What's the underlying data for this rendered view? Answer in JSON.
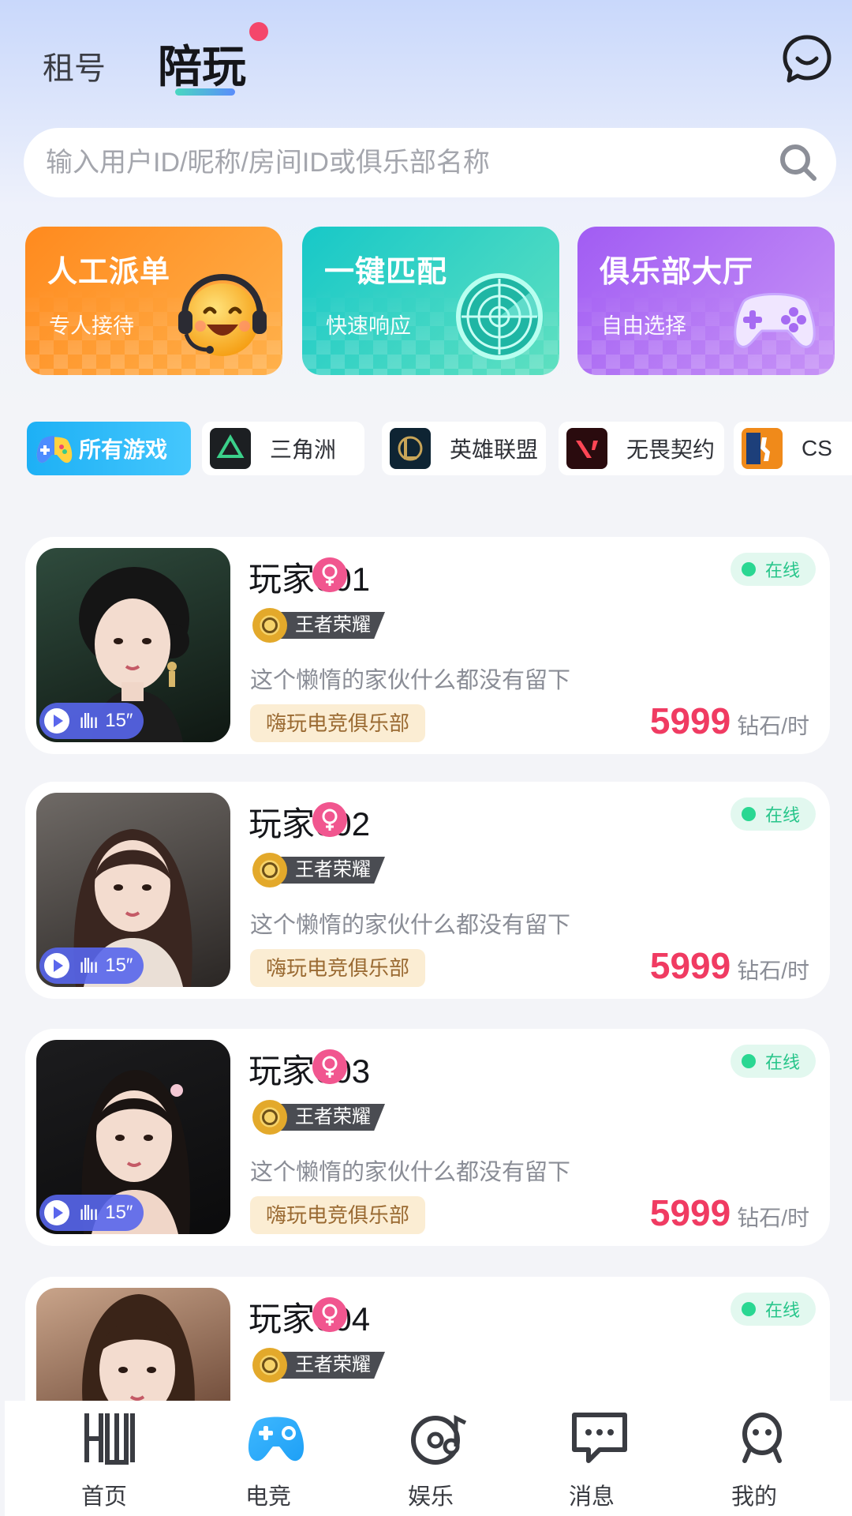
{
  "header": {
    "tab_rent": "租号",
    "tab_play": "陪玩"
  },
  "search": {
    "placeholder": "输入用户ID/昵称/房间ID或俱乐部名称"
  },
  "features": [
    {
      "title": "人工派单",
      "subtitle": "专人接待"
    },
    {
      "title": "一键匹配",
      "subtitle": "快速响应"
    },
    {
      "title": "俱乐部大厅",
      "subtitle": "自由选择"
    }
  ],
  "game_tabs": [
    {
      "label": "所有游戏",
      "active": true
    },
    {
      "label": "三角洲",
      "logo_text": "三角洲行动"
    },
    {
      "label": "英雄联盟"
    },
    {
      "label": "无畏契约",
      "logo_text": "无畏契约"
    },
    {
      "label": "CS"
    }
  ],
  "players": [
    {
      "name": "玩家001",
      "rank": "王者荣耀",
      "desc": "这个懒惰的家伙什么都没有留下",
      "club": "嗨玩电竞俱乐部",
      "status": "在线",
      "price": "5999",
      "unit": "钻石/时",
      "voice": "15″"
    },
    {
      "name": "玩家002",
      "rank": "王者荣耀",
      "desc": "这个懒惰的家伙什么都没有留下",
      "club": "嗨玩电竞俱乐部",
      "status": "在线",
      "price": "5999",
      "unit": "钻石/时",
      "voice": "15″"
    },
    {
      "name": "玩家003",
      "rank": "王者荣耀",
      "desc": "这个懒惰的家伙什么都没有留下",
      "club": "嗨玩电竞俱乐部",
      "status": "在线",
      "price": "5999",
      "unit": "钻石/时",
      "voice": "15″"
    },
    {
      "name": "玩家004",
      "rank": "王者荣耀",
      "status": "在线"
    }
  ],
  "bottom_nav": [
    {
      "label": "首页",
      "icon": "home-hw-icon"
    },
    {
      "label": "电竞",
      "icon": "gamepad-icon",
      "active": true
    },
    {
      "label": "娱乐",
      "icon": "music-disc-icon"
    },
    {
      "label": "消息",
      "icon": "chat-bubble-icon"
    },
    {
      "label": "我的",
      "icon": "profile-face-icon"
    }
  ],
  "colors": {
    "accent_blue": "#1db0f5",
    "price_red": "#f03b62",
    "online_green": "#2ad792",
    "gender_pink": "#f1568f"
  }
}
